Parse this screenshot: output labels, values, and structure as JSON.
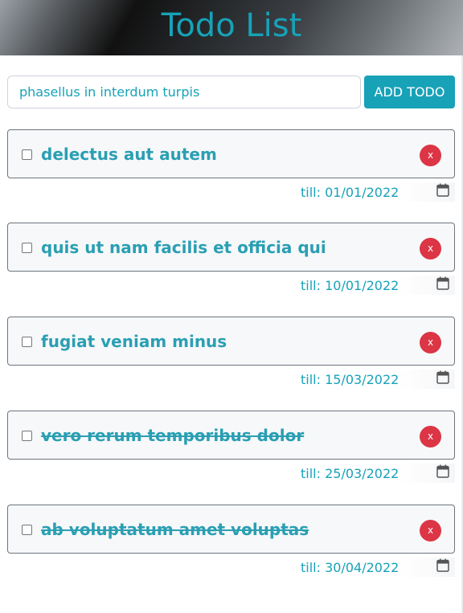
{
  "header": {
    "title": "Todo List"
  },
  "add_form": {
    "input_value": "phasellus in interdum turpis",
    "button_label": "ADD TODO"
  },
  "todos": [
    {
      "text": "delectus aut autem",
      "completed": false,
      "due_label": "till: 01/01/2022",
      "delete_label": "x"
    },
    {
      "text": "quis ut nam facilis et officia qui",
      "completed": false,
      "due_label": "till: 10/01/2022",
      "delete_label": "x"
    },
    {
      "text": "fugiat veniam minus",
      "completed": false,
      "due_label": "till: 15/03/2022",
      "delete_label": "x"
    },
    {
      "text": "vero rerum temporibus dolor",
      "completed": true,
      "due_label": "till: 25/03/2022",
      "delete_label": "x"
    },
    {
      "text": "ab voluptatum amet voluptas",
      "completed": true,
      "due_label": "till: 30/04/2022",
      "delete_label": "x"
    }
  ],
  "colors": {
    "accent": "#17a2b8",
    "delete": "#dc3545",
    "item_bg": "#f7f8fa",
    "item_border": "#6c757d"
  },
  "icons": {
    "delete": "close-icon",
    "date": "calendar-icon"
  }
}
